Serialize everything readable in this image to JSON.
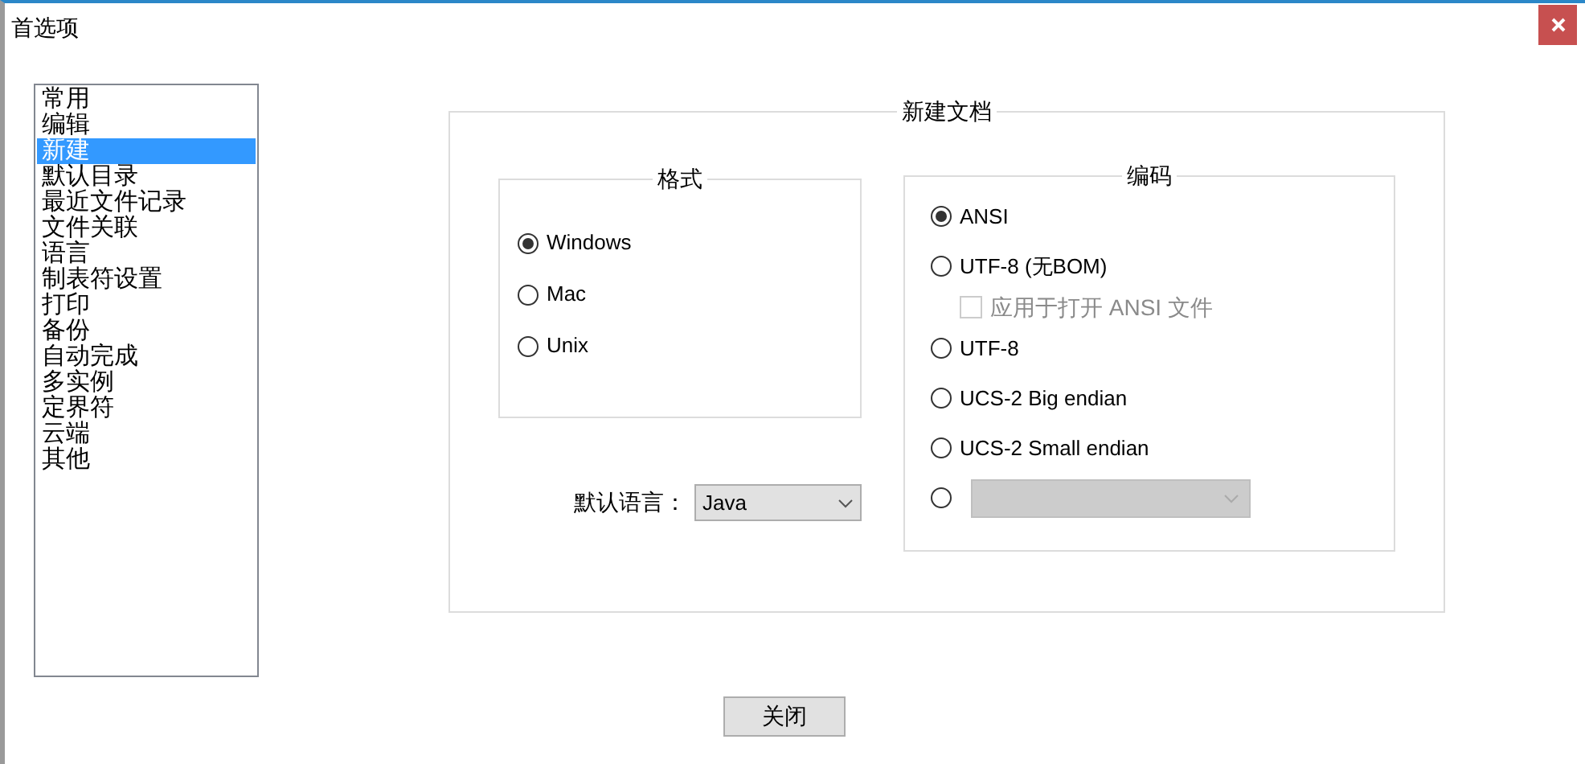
{
  "window": {
    "title": "首选项"
  },
  "categories": [
    {
      "label": "常用",
      "selected": false
    },
    {
      "label": "编辑",
      "selected": false
    },
    {
      "label": "新建",
      "selected": true
    },
    {
      "label": "默认目录",
      "selected": false
    },
    {
      "label": "最近文件记录",
      "selected": false
    },
    {
      "label": "文件关联",
      "selected": false
    },
    {
      "label": "语言",
      "selected": false
    },
    {
      "label": "制表符设置",
      "selected": false
    },
    {
      "label": "打印",
      "selected": false
    },
    {
      "label": "备份",
      "selected": false
    },
    {
      "label": "自动完成",
      "selected": false
    },
    {
      "label": "多实例",
      "selected": false
    },
    {
      "label": "定界符",
      "selected": false
    },
    {
      "label": "云端",
      "selected": false
    },
    {
      "label": "其他",
      "selected": false
    }
  ],
  "new_document": {
    "title": "新建文档",
    "format": {
      "title": "格式",
      "options": [
        {
          "label": "Windows",
          "selected": true
        },
        {
          "label": "Mac",
          "selected": false
        },
        {
          "label": "Unix",
          "selected": false
        }
      ]
    },
    "default_language": {
      "label": "默认语言：",
      "value": "Java"
    },
    "encoding": {
      "title": "编码",
      "options": [
        {
          "kind": "radio",
          "label": "ANSI",
          "selected": true
        },
        {
          "kind": "radio",
          "label": "UTF-8 (无BOM)",
          "selected": false
        },
        {
          "kind": "checkbox",
          "label": "应用于打开 ANSI 文件",
          "checked": false,
          "disabled": true
        },
        {
          "kind": "radio",
          "label": "UTF-8",
          "selected": false
        },
        {
          "kind": "radio",
          "label": "UCS-2 Big endian",
          "selected": false
        },
        {
          "kind": "radio",
          "label": "UCS-2 Small endian",
          "selected": false
        },
        {
          "kind": "radio-dropdown",
          "selected": false,
          "disabled": true
        }
      ]
    }
  },
  "buttons": [
    {
      "label": "关闭"
    }
  ]
}
